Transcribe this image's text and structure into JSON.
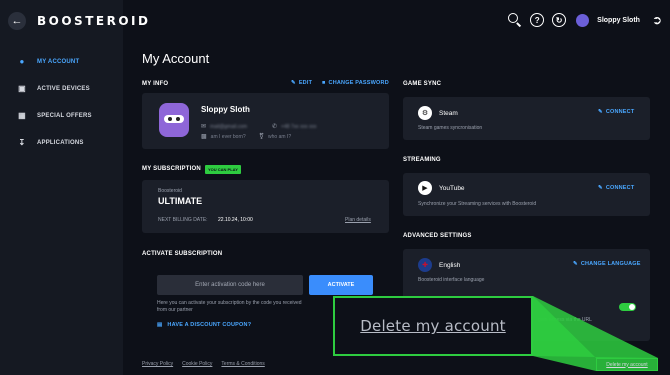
{
  "app": {
    "logo": "BOOSTEROID",
    "page_title": "My Account"
  },
  "sidebar": {
    "items": [
      {
        "label": "MY ACCOUNT",
        "icon": "user-icon",
        "active": true
      },
      {
        "label": "ACTIVE DEVICES",
        "icon": "monitor-icon",
        "active": false
      },
      {
        "label": "SPECIAL OFFERS",
        "icon": "gift-icon",
        "active": false
      },
      {
        "label": "APPLICATIONS",
        "icon": "download-icon",
        "active": false
      }
    ]
  },
  "topbar": {
    "username": "Sloppy Sloth",
    "icons": [
      "search-icon",
      "help-icon",
      "speed-icon",
      "avatar",
      "logout-icon"
    ]
  },
  "my_info": {
    "title": "MY INFO",
    "edit": "EDIT",
    "change_password": "CHANGE PASSWORD",
    "name": "Sloppy Sloth",
    "email": "mail@gmail.com",
    "phone": "+48 7xx xxx xxx",
    "where": "am I ever born?",
    "who": "who am I?"
  },
  "subscription": {
    "title": "MY SUBSCRIPTION",
    "badge": "YOU CAN PLAY",
    "provider": "Boosteroid",
    "plan": "ULTIMATE",
    "billing_label": "NEXT BILLING DATE:",
    "billing_date": "22.10.24, 10:00",
    "plan_details": "Plan details"
  },
  "activate": {
    "title": "ACTIVATE SUBSCRIPTION",
    "placeholder": "Enter activation code here",
    "button": "ACTIVATE",
    "description": "Here you can activate your subscription by the code you received from our partner",
    "coupon": "HAVE A DISCOUNT COUPON?"
  },
  "game_sync": {
    "title": "GAME SYNC",
    "service": "Steam",
    "desc": "Steam games syncronisation",
    "connect": "CONNECT"
  },
  "streaming": {
    "title": "STREAMING",
    "service": "YouTube",
    "desc": "Synchronize your Streaming services with Boosteroid",
    "connect": "CONNECT"
  },
  "advanced": {
    "title": "ADVANCED SETTINGS",
    "language": "English",
    "language_desc": "Boosteroid interface language",
    "change_language": "CHANGE LANGUAGE",
    "partial_text": "gain access via the URL"
  },
  "footer": {
    "links": [
      "Privacy Policy",
      "Cookie Policy",
      "Terms & Conditions"
    ]
  },
  "delete": {
    "zoom_label": "Delete my account",
    "small_label": "Delete my account"
  },
  "colors": {
    "accent": "#4aa7ff",
    "highlight": "#2ecc40",
    "background": "#0d1018",
    "card": "#1b1f29"
  }
}
